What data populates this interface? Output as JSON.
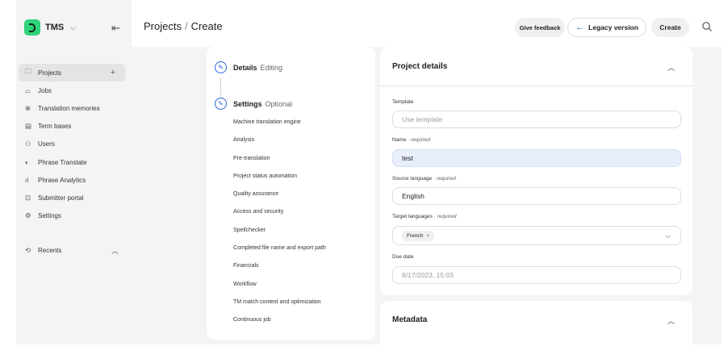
{
  "app": {
    "name": "TMS"
  },
  "sidebar": {
    "items": [
      {
        "label": "Projects",
        "icon": "folder-icon",
        "glyph": "🗀"
      },
      {
        "label": "Jobs",
        "icon": "briefcase-icon",
        "glyph": "⌓"
      },
      {
        "label": "Translation memories",
        "icon": "globe-icon",
        "glyph": "⊕"
      },
      {
        "label": "Term bases",
        "icon": "book-icon",
        "glyph": "▤"
      },
      {
        "label": "Users",
        "icon": "users-icon",
        "glyph": "⚇"
      },
      {
        "label": "Phrase Translate",
        "icon": "translate-icon",
        "glyph": "◐"
      },
      {
        "label": "Phrase Analytics",
        "icon": "bar-chart-icon",
        "glyph": "ıl"
      },
      {
        "label": "Submitter portal",
        "icon": "portal-icon",
        "glyph": "⊡"
      },
      {
        "label": "Settings",
        "icon": "gear-icon",
        "glyph": "⚙"
      }
    ],
    "recents_label": "Recents"
  },
  "header": {
    "breadcrumb_root": "Projects",
    "breadcrumb_current": "Create",
    "feedback_label": "Give feedback",
    "legacy_label": "Legacy version",
    "create_label": "Create"
  },
  "steps": {
    "details": {
      "title": "Details",
      "sub": "Editing"
    },
    "settings": {
      "title": "Settings",
      "sub": "Optional"
    },
    "settings_items": [
      "Machine translation engine",
      "Analysis",
      "Pre-translation",
      "Project status automation",
      "Quality assurance",
      "Access and security",
      "Spellchecker",
      "Completed file name and export path",
      "Financials",
      "Workflow",
      "TM match context and optimization",
      "Continuous job"
    ]
  },
  "project_details": {
    "title": "Project details",
    "template": {
      "label": "Template",
      "placeholder": "Use template"
    },
    "name": {
      "label": "Name",
      "required": "· required",
      "value": "test"
    },
    "source": {
      "label": "Source language",
      "required": "· required",
      "value": "English"
    },
    "target": {
      "label": "Target languages",
      "required": "· required",
      "chip": "French",
      "chip_x": "×"
    },
    "due": {
      "label": "Due date",
      "placeholder": "8/17/2023, 15:03"
    }
  },
  "metadata": {
    "title": "Metadata"
  },
  "colors": {
    "accent": "#2a64d8",
    "brand": "#2fd37a",
    "sidebar_bg": "#f4f4f4"
  }
}
